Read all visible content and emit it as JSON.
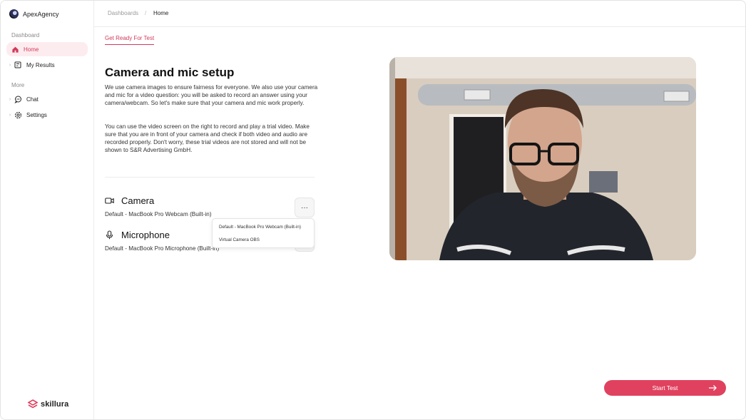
{
  "app": {
    "name": "ApexAgency",
    "footer_brand": "skillura"
  },
  "sidebar": {
    "sections": [
      {
        "label": "Dashboard"
      },
      {
        "label": "More"
      }
    ],
    "items": [
      {
        "label": "Home",
        "icon": "home-icon",
        "active": true
      },
      {
        "label": "My Results",
        "icon": "results-icon"
      },
      {
        "label": "Chat",
        "icon": "chat-icon"
      },
      {
        "label": "Settings",
        "icon": "gear-icon"
      }
    ]
  },
  "breadcrumb": {
    "items": [
      "Dashboards",
      "Home"
    ],
    "separator": "/"
  },
  "tabs": [
    {
      "label": "Get Ready For Test",
      "active": true
    }
  ],
  "main": {
    "title": "Camera and mic setup",
    "paragraph1": " We use camera images to ensure fairness for everyone. We also use your camera and mic for a video question: you will be asked to record an answer using your camera/webcam. So let's make sure that your camera and mic work properly.",
    "paragraph2": "You can use the video screen on the right to record and play a trial video. Make sure that you are in front of your camera and check if both video and audio are recorded properly. Don't worry, these trial videos are not stored and will not be shown to S&R Advertising GmbH."
  },
  "camera": {
    "title": "Camera",
    "selected": "Default - MacBook Pro Webcam (Built-in)",
    "more_label": "···"
  },
  "microphone": {
    "title": "Microphone",
    "selected": "Default - MacBook Pro Microphone (Built-in)"
  },
  "camera_dropdown": {
    "options": [
      "Default - MacBook Pro Webcam (Built-in)",
      "Virtual Camera OBS"
    ]
  },
  "start_button": {
    "label": "Start Test"
  },
  "colors": {
    "accent": "#e0415f",
    "active_bg": "#fdecef"
  }
}
